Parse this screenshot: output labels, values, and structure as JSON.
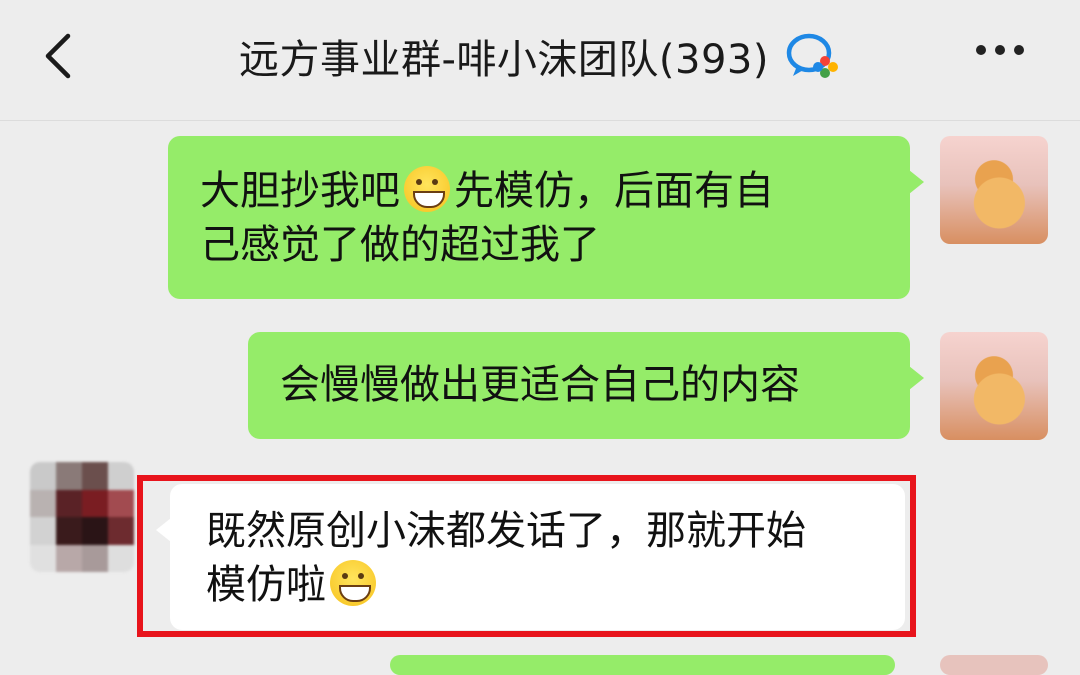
{
  "header": {
    "back_icon": "chevron-left-icon",
    "title": "远方事业群-啡小沫团队(393)",
    "badge_icon": "enterprise-chat-icon",
    "more_icon": "more-dots-icon"
  },
  "messages": [
    {
      "direction": "outgoing",
      "lines": [
        "大胆抄我吧",
        "先模仿，后面有自",
        "己感觉了做的超过我了"
      ],
      "emoji": "grin-emoji"
    },
    {
      "direction": "outgoing",
      "lines": [
        "会慢慢做出更适合自己的内容"
      ]
    },
    {
      "direction": "incoming",
      "lines": [
        "既然原创小沫都发话了，那就开始",
        "模仿啦"
      ],
      "emoji": "grin-emoji",
      "highlighted": true
    }
  ],
  "colors": {
    "background": "#ededed",
    "outgoing_bubble": "#95ec69",
    "incoming_bubble": "#ffffff",
    "highlight_border": "#e8141c"
  }
}
